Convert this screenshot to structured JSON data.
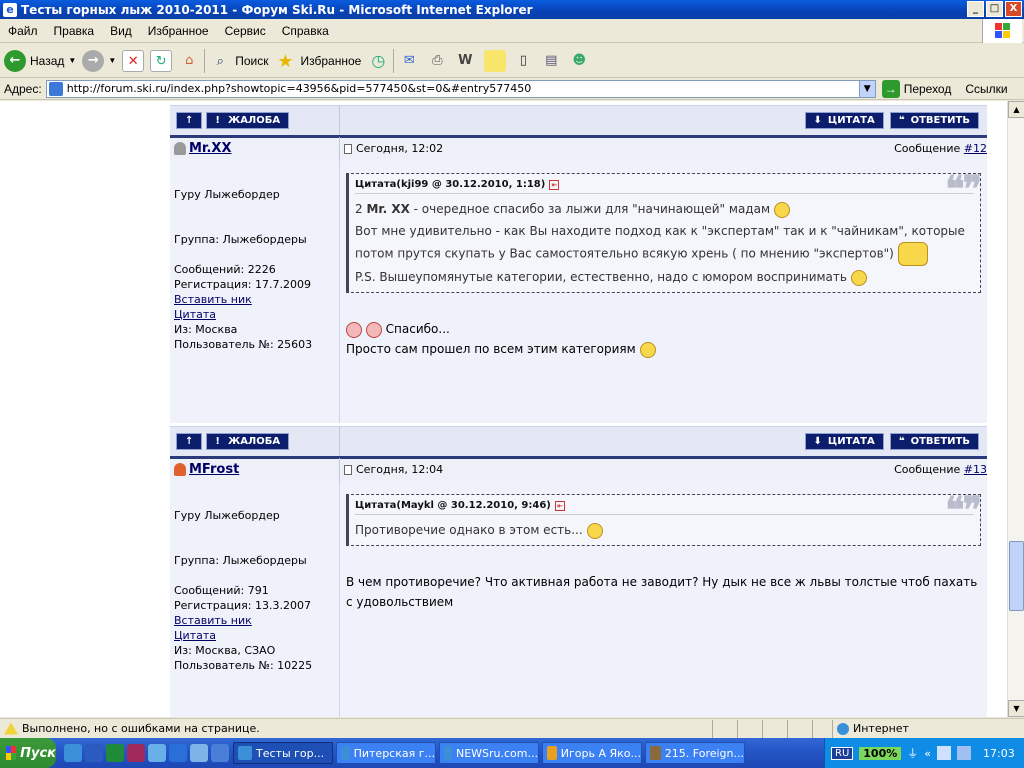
{
  "window": {
    "title": "Тесты горных лыж 2010-2011 - Форум Ski.Ru - Microsoft Internet Explorer",
    "min": "_",
    "max": "□",
    "close": "X"
  },
  "menu": [
    "Файл",
    "Правка",
    "Вид",
    "Избранное",
    "Сервис",
    "Справка"
  ],
  "toolbar": {
    "back": "Назад",
    "search": "Поиск",
    "favorites": "Избранное"
  },
  "address": {
    "label": "Адрес:",
    "url": "http://forum.ski.ru/index.php?showtopic=43956&pid=577450&st=0&#entry577450",
    "go": "Переход",
    "links": "Ссылки"
  },
  "post_buttons": {
    "up": "↑",
    "report": "ЖАЛОБА",
    "quote": "ЦИТАТА",
    "reply": "ОТВЕТИТЬ"
  },
  "posts": [
    {
      "author": "Mr.XX",
      "date": "Сегодня, 12:02",
      "msg_label": "Сообщение ",
      "msg_num": "#12",
      "rank": "Гуру Лыжебордер",
      "group": "Группа: Лыжебордеры",
      "messages": "Сообщений: 2226",
      "registered": "Регистрация: 17.7.2009",
      "insert_nick": "Вставить ник",
      "quote_link": "Цитата",
      "from": "Из: Москва",
      "user_no": "Пользователь №: 25603",
      "quote_head": "Цитата(kji99 @ 30.12.2010, 1:18)",
      "quote_line1": "2 ",
      "quote_line1_nick": "Mr. XX",
      "quote_line1_rest": " - очередное спасибо за лыжи для \"начинающей\" мадам",
      "quote_line2": "Вот мне удивительно - как Вы находите подход как к \"экспертам\" так и к \"чайникам\", которые потом прутся скупать у Вас самостоятельно всякую хрень ( по мнению \"экспертов\")",
      "quote_line3": "P.S. Вышеупомянутые категории, естественно, надо с юмором воспринимать",
      "reply_line1": "Спасибо...",
      "reply_line2": "Просто сам прошел по всем этим категориям"
    },
    {
      "author": "MFrost",
      "date": "Сегодня, 12:04",
      "msg_label": "Сообщение ",
      "msg_num": "#13",
      "rank": "Гуру Лыжебордер",
      "group": "Группа: Лыжебордеры",
      "messages": "Сообщений: 791",
      "registered": "Регистрация: 13.3.2007",
      "insert_nick": "Вставить ник",
      "quote_link": "Цитата",
      "from": "Из: Москва, СЗАО",
      "user_no": "Пользователь №: 10225",
      "quote_head": "Цитата(Maykl @ 30.12.2010, 9:46)",
      "quote_text": "Противоречие однако в этом есть...",
      "reply_text": "В чем противоречие? Что активная работа не заводит? Ну дык не все ж львы толстые чтоб пахать с удовольствием"
    }
  ],
  "status": {
    "text": "Выполнено, но с ошибками на странице.",
    "zone": "Интернет"
  },
  "taskbar": {
    "start": "Пуск",
    "tasks": [
      "Тесты гор...",
      "Питерская г...",
      "NEWSru.com...",
      "Игорь А Яко...",
      "215. Foreign..."
    ],
    "lang": "RU",
    "battery": "100%",
    "clock": "17:03"
  }
}
